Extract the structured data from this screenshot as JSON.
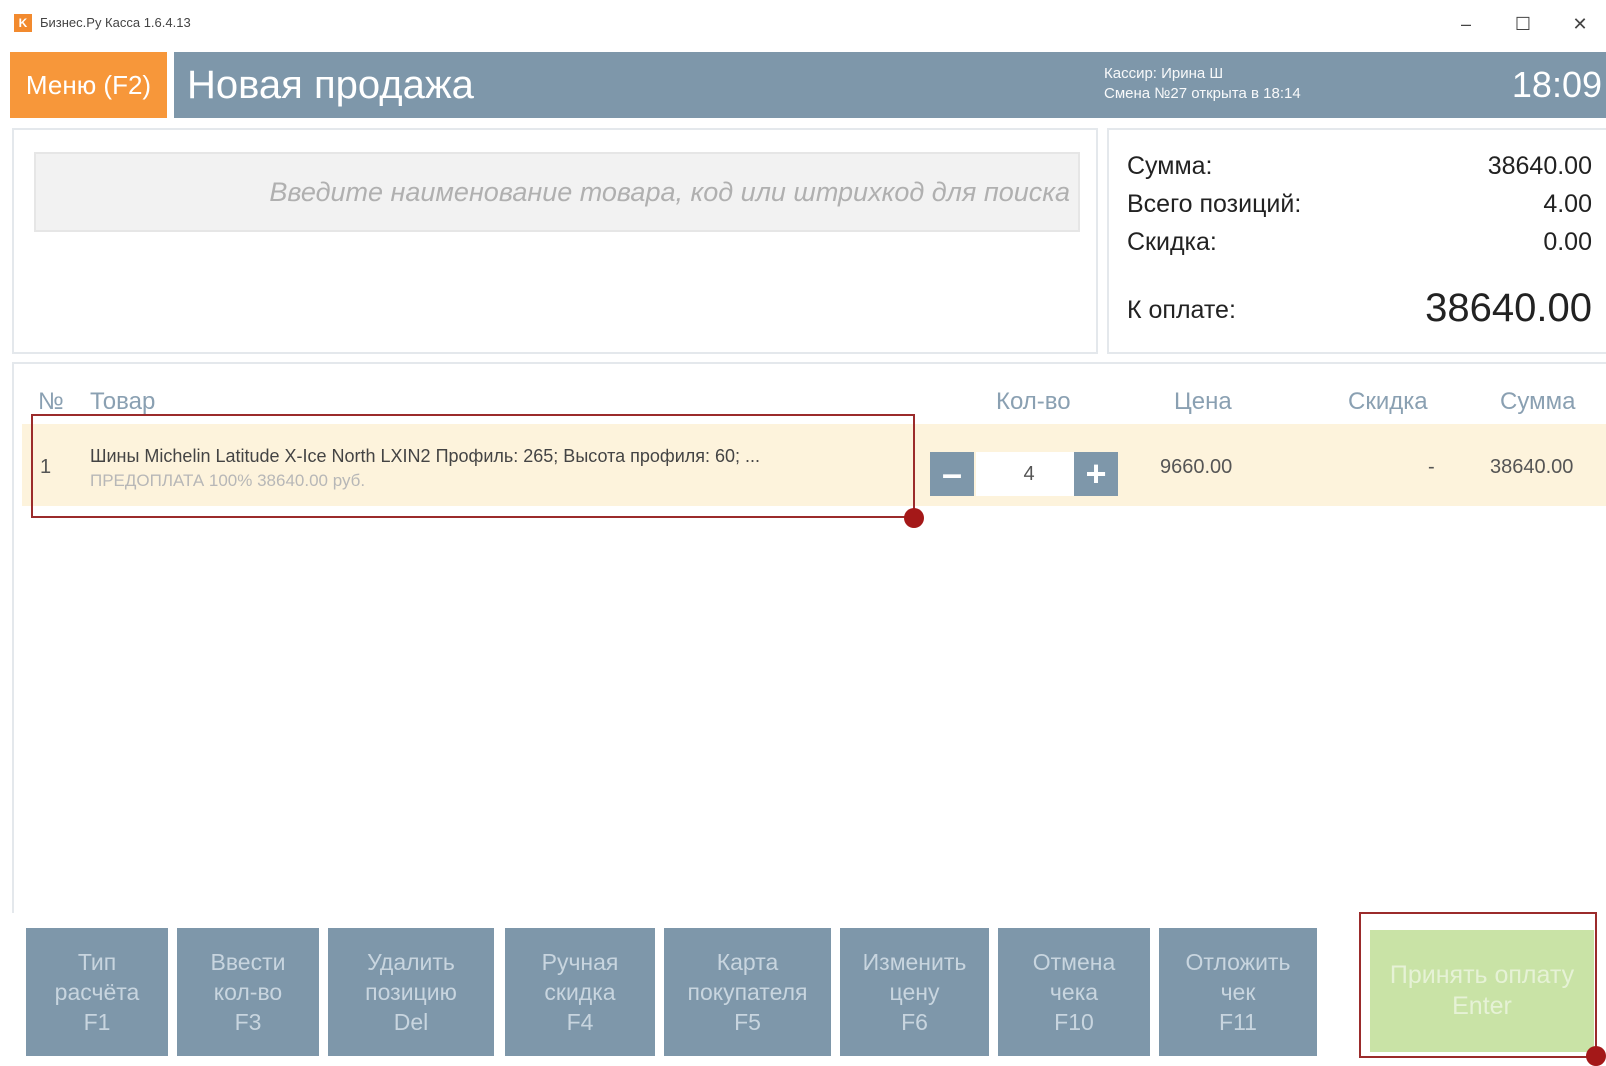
{
  "window": {
    "icon_letter": "K",
    "title": "Бизнес.Ру Касса 1.6.4.13",
    "controls": [
      "–",
      "☐",
      "✕"
    ]
  },
  "header": {
    "menu_label": "Меню (F2)",
    "title": "Новая продажа",
    "cashier": "Кассир: Ирина Ш",
    "shift": "Смена №27 открыта в 18:14",
    "time": "18:09"
  },
  "search": {
    "placeholder": "Введите наименование товара, код или штрихкод для поиска",
    "value": ""
  },
  "totals": {
    "sum_label": "Сумма:",
    "sum_value": "38640.00",
    "positions_label": "Всего позиций:",
    "positions_value": "4.00",
    "discount_label": "Скидка:",
    "discount_value": "0.00",
    "to_pay_label": "К оплате:",
    "to_pay_value": "38640.00"
  },
  "table": {
    "headers": {
      "num": "№",
      "product": "Товар",
      "qty": "Кол-во",
      "price": "Цена",
      "discount": "Скидка",
      "sum": "Сумма"
    },
    "rows": [
      {
        "num": "1",
        "name": "Шины Michelin Latitude X-Ice North LXIN2 Профиль: 265; Высота профиля: 60; ...",
        "subtitle": "ПРЕДОПЛАТА 100% 38640.00 руб.",
        "minus": "–",
        "qty": "4",
        "plus": "+",
        "price": "9660.00",
        "discount": "-",
        "sum": "38640.00"
      }
    ]
  },
  "functions": [
    {
      "l1": "Тип",
      "l2": "расчёта",
      "key": "F1"
    },
    {
      "l1": "Ввести",
      "l2": "кол-во",
      "key": "F3"
    },
    {
      "l1": "Удалить",
      "l2": "позицию",
      "key": "Del"
    },
    {
      "l1": "Ручная",
      "l2": "скидка",
      "key": "F4"
    },
    {
      "l1": "Карта",
      "l2": "покупателя",
      "key": "F5"
    },
    {
      "l1": "Изменить",
      "l2": "цену",
      "key": "F6"
    },
    {
      "l1": "Отмена",
      "l2": "чека",
      "key": "F10"
    },
    {
      "l1": "Отложить",
      "l2": "чек",
      "key": "F11"
    }
  ],
  "pay": {
    "label": "Принять оплату",
    "key": "Enter"
  },
  "colors": {
    "menu_orange": "#f7973a",
    "header_slate": "#7e97aa",
    "row_highlight": "#fdf3dc",
    "pay_green": "#c9e3a6",
    "annotation_red": "#9b2b2b"
  }
}
